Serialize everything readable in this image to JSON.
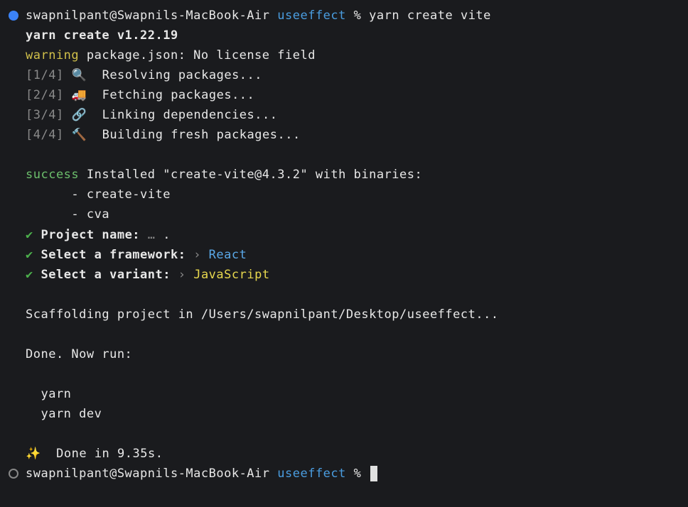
{
  "prompt1": {
    "user_host": "swapnilpant@Swapnils-MacBook-Air",
    "dir": "useeffect",
    "symbol": "%",
    "command": "yarn create vite"
  },
  "yarn_create_line": "yarn create v1.22.19",
  "warning_label": "warning",
  "warning_msg": " package.json: No license field",
  "steps": {
    "s1_num": "[1/4]",
    "s1_icon": "🔍",
    "s1_msg": "  Resolving packages...",
    "s2_num": "[2/4]",
    "s2_icon": "🚚",
    "s2_msg": "  Fetching packages...",
    "s3_num": "[3/4]",
    "s3_icon": "🔗",
    "s3_msg": "  Linking dependencies...",
    "s4_num": "[4/4]",
    "s4_icon": "🔨",
    "s4_msg": "  Building fresh packages..."
  },
  "success_label": "success",
  "success_msg": " Installed \"create-vite@4.3.2\" with binaries:",
  "bin1": "      - create-vite",
  "bin2": "      - cva",
  "check": "✔",
  "q1_label": " Project name:",
  "q1_sep": " …",
  "q1_val": " .",
  "q2_label": " Select a framework:",
  "q2_sep": " ›",
  "q2_val": " React",
  "q3_label": " Select a variant:",
  "q3_sep": " ›",
  "q3_val": " JavaScript",
  "scaffold": "Scaffolding project in /Users/swapnilpant/Desktop/useeffect...",
  "done_now_run": "Done. Now run:",
  "cmd1": "  yarn",
  "cmd2": "  yarn dev",
  "sparkle": "✨",
  "done_time": "  Done in 9.35s.",
  "prompt2": {
    "user_host": "swapnilpant@Swapnils-MacBook-Air",
    "dir": "useeffect",
    "symbol": "%"
  }
}
